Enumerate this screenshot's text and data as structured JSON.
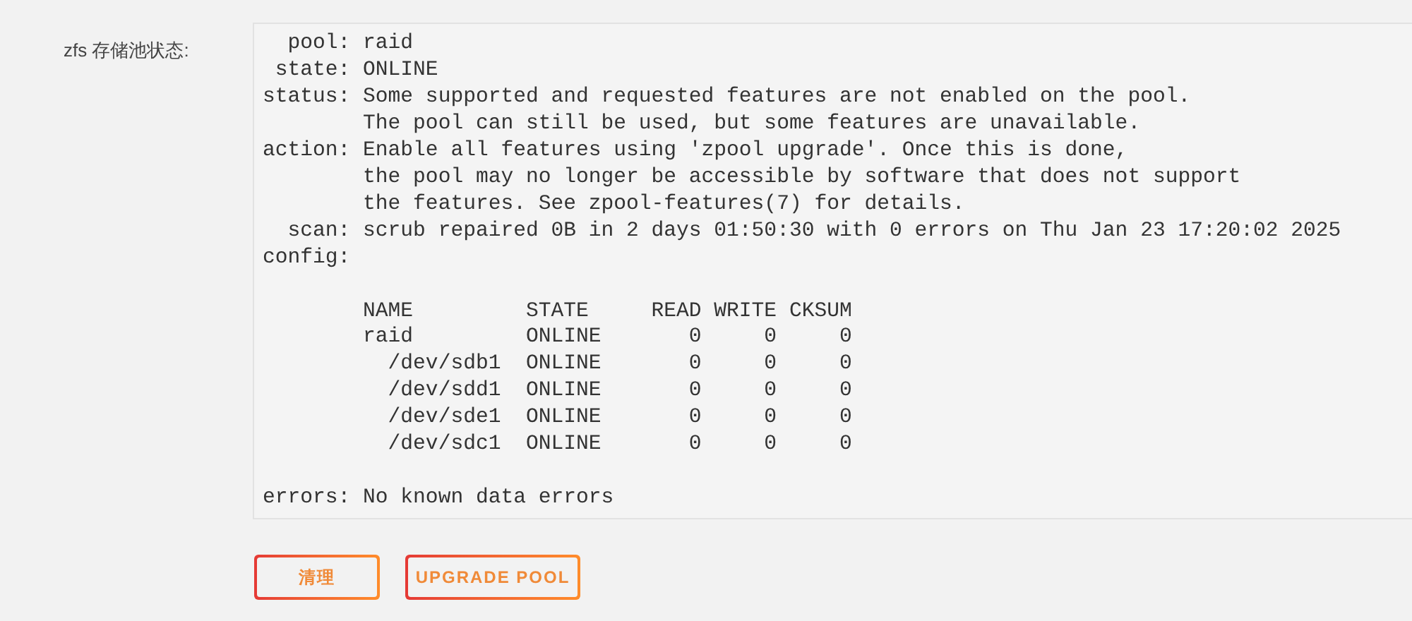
{
  "field": {
    "label": "zfs 存储池状态:",
    "output": "  pool: raid\n state: ONLINE\nstatus: Some supported and requested features are not enabled on the pool.\n        The pool can still be used, but some features are unavailable.\naction: Enable all features using 'zpool upgrade'. Once this is done,\n        the pool may no longer be accessible by software that does not support\n        the features. See zpool-features(7) for details.\n  scan: scrub repaired 0B in 2 days 01:50:30 with 0 errors on Thu Jan 23 17:20:02 2025\nconfig:\n\n        NAME         STATE     READ WRITE CKSUM\n        raid         ONLINE       0     0     0\n          /dev/sdb1  ONLINE       0     0     0\n          /dev/sdd1  ONLINE       0     0     0\n          /dev/sde1  ONLINE       0     0     0\n          /dev/sdc1  ONLINE       0     0     0\n\nerrors: No known data errors"
  },
  "buttons": [
    {
      "label": "清理",
      "kind": "clean"
    },
    {
      "label": "UPGRADE POOL",
      "kind": "upgrade"
    }
  ]
}
